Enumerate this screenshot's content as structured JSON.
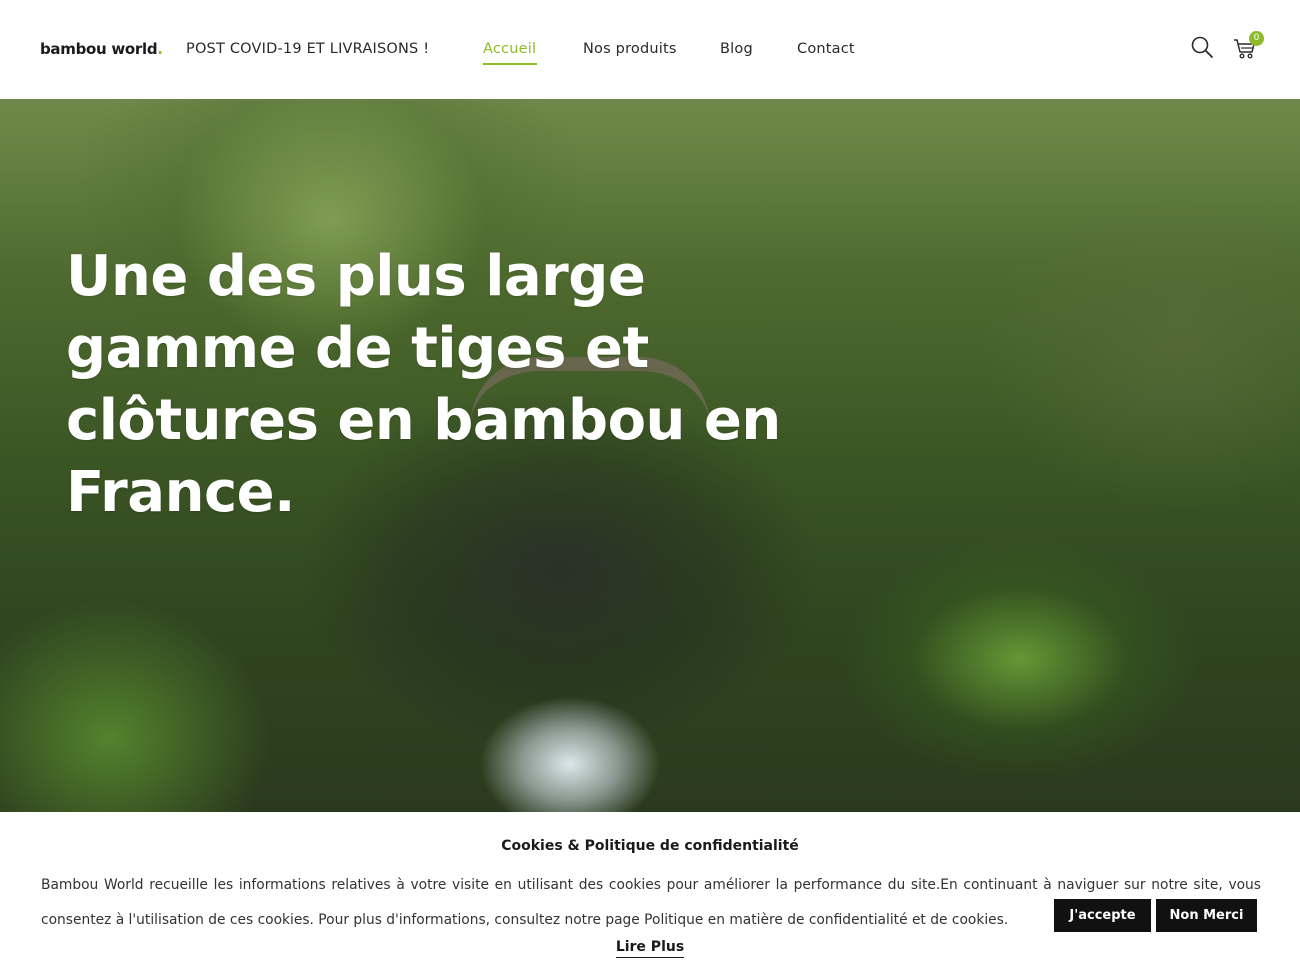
{
  "header": {
    "logo_text": "bambou world",
    "logo_dot": ".",
    "nav": [
      {
        "label": "POST COVID-19 ET LIVRAISONS !"
      },
      {
        "label": "Accueil"
      },
      {
        "label": "Nos produits"
      },
      {
        "label": "Blog"
      },
      {
        "label": "Contact"
      }
    ],
    "active_nav": "Accueil",
    "search_icon": "search-icon",
    "cart_icon": "cart-icon",
    "cart_count": "0",
    "accent_color": "#8dbb2a"
  },
  "hero": {
    "title": "Une des plus large gamme de tiges et clôtures en bambou en France."
  },
  "cookie_banner": {
    "title": "Cookies & Politique de confidentialité",
    "text": "Bambou World recueille les informations relatives à votre visite en utilisant des cookies pour améliorer la performance du site.En continuant à naviguer sur notre site, vous consentez à l'utilisation de ces cookies. Pour plus d'informations, consultez notre page Politique en matière de confidentialité et de cookies.",
    "accept_label": "J'accepte",
    "decline_label": "Non Merci",
    "read_more_label": "Lire Plus"
  }
}
